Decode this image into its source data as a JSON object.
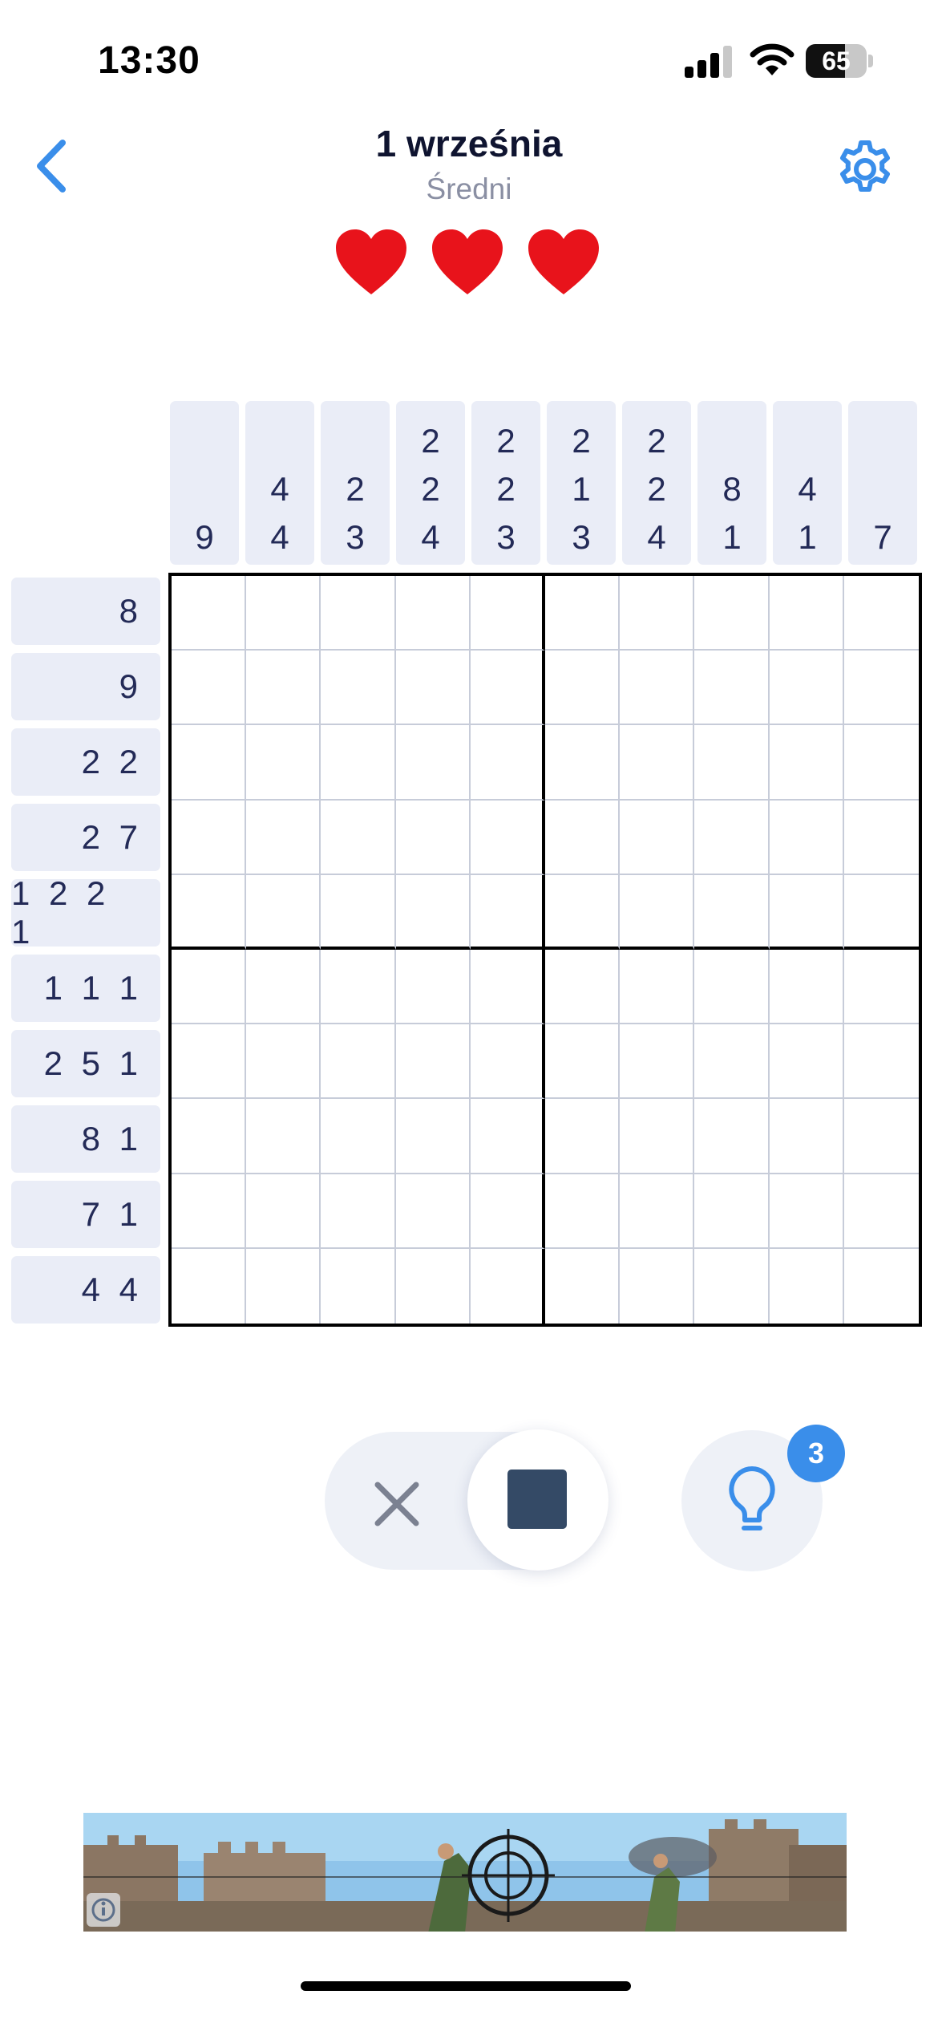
{
  "status_bar": {
    "time": "13:30",
    "battery": "65",
    "battery_level": 0.65
  },
  "header": {
    "title": "1 września",
    "subtitle": "Średni",
    "lives": 3
  },
  "puzzle": {
    "size": 10,
    "column_clues": [
      [
        "9"
      ],
      [
        "4",
        "4"
      ],
      [
        "2",
        "3"
      ],
      [
        "2",
        "2",
        "4"
      ],
      [
        "2",
        "2",
        "3"
      ],
      [
        "2",
        "1",
        "3"
      ],
      [
        "2",
        "2",
        "4"
      ],
      [
        "8",
        "1"
      ],
      [
        "4",
        "1"
      ],
      [
        "7"
      ]
    ],
    "row_clues": [
      "8",
      "9",
      "2 2",
      "2 7",
      "1 2 2 1",
      "1 1 1",
      "2 5 1",
      "8 1",
      "7 1",
      "4 4"
    ]
  },
  "controls": {
    "cross_mode_icon": "cross-icon",
    "fill_mode_icon": "filled-square-icon",
    "active_mode": "fill",
    "hint_icon": "lightbulb-icon",
    "hints_remaining": "3"
  },
  "colors": {
    "accent": "#3a8eea",
    "heart": "#e8131b",
    "clue_bg": "#eaedf7",
    "clue_text": "#232a57",
    "fill_square": "#344a66"
  }
}
